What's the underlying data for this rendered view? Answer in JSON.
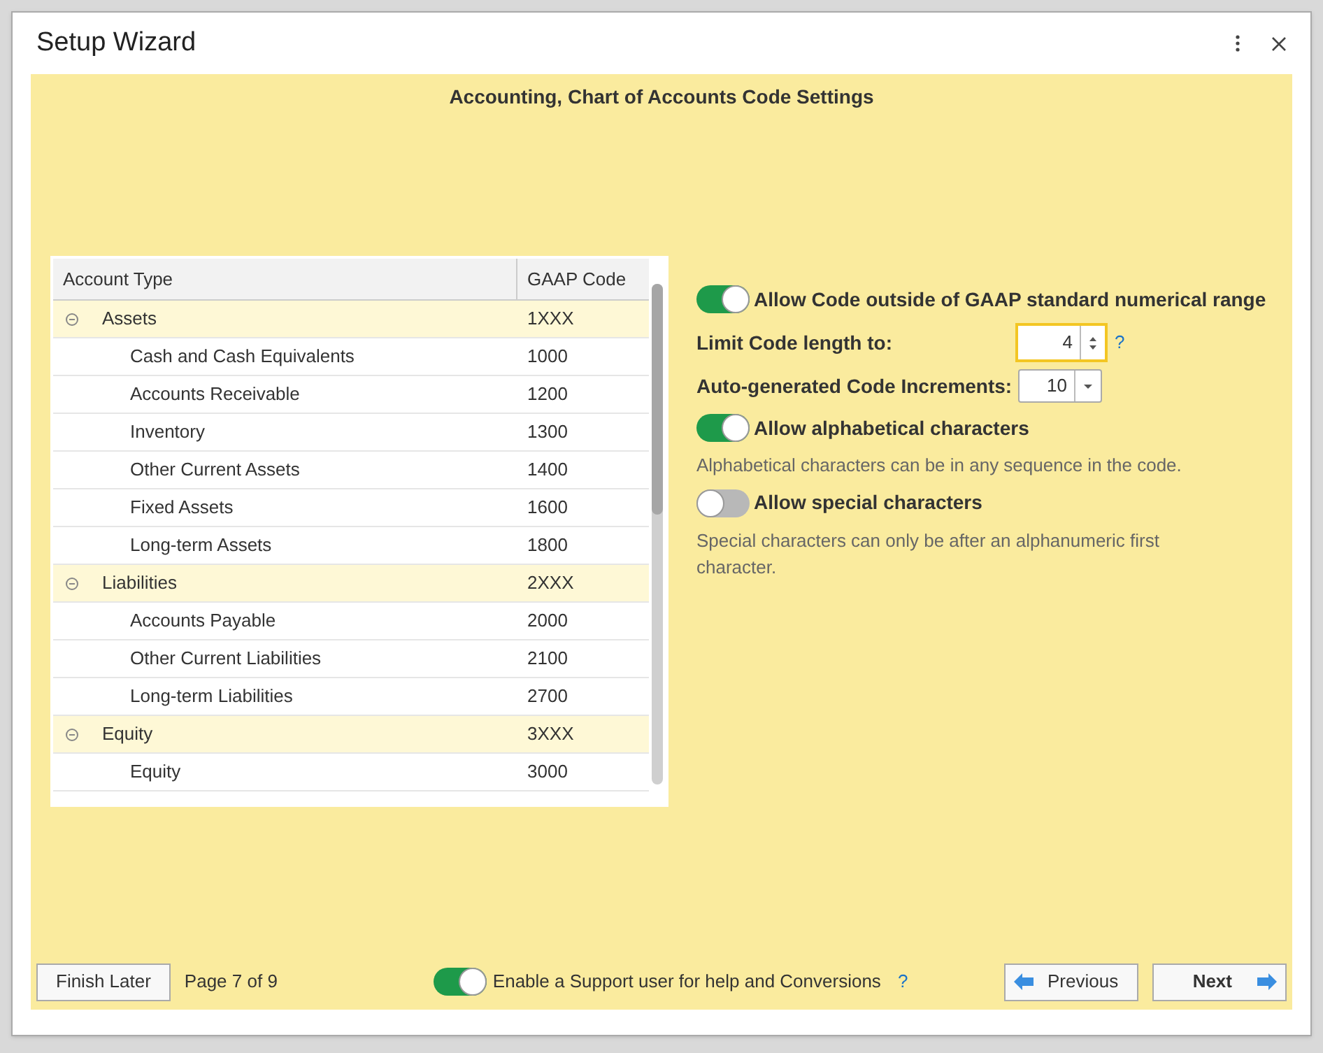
{
  "window": {
    "title": "Setup Wizard"
  },
  "page_title": "Accounting, Chart of Accounts Code Settings",
  "table": {
    "columns": [
      "Account Type",
      "GAAP Code"
    ],
    "rows": [
      {
        "name": "Assets",
        "code": "1XXX",
        "expanded": true,
        "children": [
          {
            "name": "Cash and Cash Equivalents",
            "code": "1000"
          },
          {
            "name": "Accounts Receivable",
            "code": "1200"
          },
          {
            "name": "Inventory",
            "code": "1300"
          },
          {
            "name": "Other Current Assets",
            "code": "1400"
          },
          {
            "name": "Fixed Assets",
            "code": "1600"
          },
          {
            "name": "Long-term Assets",
            "code": "1800"
          }
        ]
      },
      {
        "name": "Liabilities",
        "code": "2XXX",
        "expanded": true,
        "children": [
          {
            "name": "Accounts Payable",
            "code": "2000"
          },
          {
            "name": "Other Current Liabilities",
            "code": "2100"
          },
          {
            "name": "Long-term Liabilities",
            "code": "2700"
          }
        ]
      },
      {
        "name": "Equity",
        "code": "3XXX",
        "expanded": true,
        "children": [
          {
            "name": "Equity",
            "code": "3000"
          }
        ]
      }
    ]
  },
  "settings": [
    {
      "kind": "toggle",
      "label": "Allow Code outside of GAAP standard numerical range",
      "on": true
    },
    {
      "kind": "spinner",
      "label": "Limit Code length to:",
      "value": "4",
      "help": "?"
    },
    {
      "kind": "dropdown",
      "label": "Auto-generated Code Increments:",
      "value": "10"
    },
    {
      "kind": "toggle",
      "label": "Allow alphabetical characters",
      "on": true,
      "note": "Alphabetical characters can be in any sequence in the code."
    },
    {
      "kind": "toggle",
      "label": "Allow special characters",
      "on": false,
      "note": "Special characters can only be after an alphanumeric first character."
    }
  ],
  "footer": {
    "finish_later": "Finish Later",
    "page": "Page 7 of 9",
    "support": {
      "label": "Enable a Support user for help and Conversions",
      "on": true,
      "help": "?"
    },
    "previous": "Previous",
    "next": "Next"
  }
}
